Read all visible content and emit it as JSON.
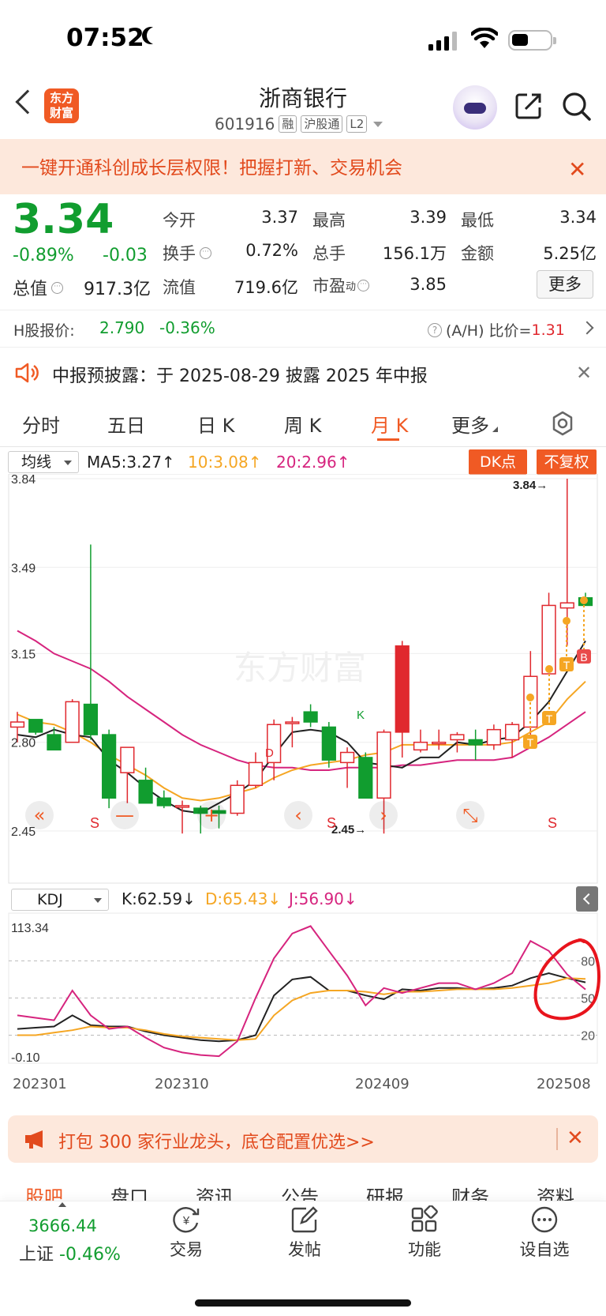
{
  "status_bar": {
    "time": "07:52"
  },
  "header": {
    "logo_text": "东方财富",
    "title": "浙商银行",
    "code": "601916",
    "tags": [
      "融",
      "沪股通",
      "L2"
    ]
  },
  "promo": {
    "text": "一键开通科创成长层权限！把握打新、交易机会",
    "close": "✕"
  },
  "quote": {
    "price": "3.34",
    "change_pct": "-0.89%",
    "change": "-0.03",
    "market_cap_label": "总值",
    "market_cap": "917.3亿",
    "fields": [
      {
        "label": "今开",
        "value": "3.37",
        "color": "#222222"
      },
      {
        "label": "最高",
        "value": "3.39",
        "color": "#e0282e"
      },
      {
        "label": "最低",
        "value": "3.34",
        "color": "#119d2f"
      },
      {
        "label": "换手",
        "value": "0.72%",
        "color": "#222222"
      },
      {
        "label": "总手",
        "value": "156.1万",
        "color": "#222222"
      },
      {
        "label": "金额",
        "value": "5.25亿",
        "color": "#222222"
      },
      {
        "label": "流值",
        "value": "719.6亿",
        "color": "#222222"
      },
      {
        "label": "市盈",
        "value": "3.85",
        "color": "#222222"
      }
    ],
    "pe_sup": "动",
    "more_label": "更多"
  },
  "hshare": {
    "label": "H股报价:",
    "price": "2.790",
    "change": "-0.36%",
    "ah_label": "(A/H) 比价=",
    "ah_value": "1.31"
  },
  "notice": {
    "text": "中报预披露：于 2025-08-29 披露 2025 年中报"
  },
  "period_tabs": [
    "分时",
    "五日",
    "日 K",
    "周 K",
    "月 K",
    "更多"
  ],
  "active_tab": "月 K",
  "indicators": {
    "ma_select": "均线",
    "ma5": "MA5:3.27↑",
    "ma10": "10:3.08↑",
    "ma20": "20:2.96↑",
    "dk_button": "DK点",
    "fq_button": "不复权",
    "kdj_select": "KDJ",
    "kdj_k": "K:62.59↓",
    "kdj_d": "D:65.43↓",
    "kdj_j": "J:56.90↓"
  },
  "colors": {
    "up": "#e0282e",
    "down": "#119d2f",
    "ma5": "#222222",
    "ma10": "#f5a623",
    "ma20": "#d6247e",
    "accent": "#f05a24"
  },
  "chart_data": [
    {
      "type": "candlestick",
      "title": "",
      "y_ticks": [
        "3.84",
        "3.49",
        "3.15",
        "2.80",
        "2.45"
      ],
      "ylim": [
        2.45,
        3.84
      ],
      "annotations": {
        "high": "3.84→",
        "low": "2.45→",
        "watermark": "东方财富",
        "markers": [
          "S",
          "S",
          "S",
          "S",
          "D",
          "B",
          "K",
          "T",
          "T",
          "T",
          "T"
        ]
      },
      "candles": [
        {
          "o": 2.86,
          "h": 2.92,
          "l": 2.8,
          "c": 2.88
        },
        {
          "o": 2.89,
          "h": 2.88,
          "l": 2.83,
          "c": 2.84
        },
        {
          "o": 2.83,
          "h": 2.86,
          "l": 2.77,
          "c": 2.77
        },
        {
          "o": 2.8,
          "h": 2.97,
          "l": 2.8,
          "c": 2.96
        },
        {
          "o": 2.95,
          "h": 3.58,
          "l": 2.81,
          "c": 2.83
        },
        {
          "o": 2.83,
          "h": 2.85,
          "l": 2.54,
          "c": 2.58
        },
        {
          "o": 2.68,
          "h": 2.7,
          "l": 2.56,
          "c": 2.78
        },
        {
          "o": 2.65,
          "h": 2.7,
          "l": 2.56,
          "c": 2.56
        },
        {
          "o": 2.58,
          "h": 2.61,
          "l": 2.54,
          "c": 2.55
        },
        {
          "o": 2.55,
          "h": 2.57,
          "l": 2.44,
          "c": 2.55
        },
        {
          "o": 2.54,
          "h": 2.55,
          "l": 2.44,
          "c": 2.52
        },
        {
          "o": 2.53,
          "h": 2.55,
          "l": 2.46,
          "c": 2.52
        },
        {
          "o": 2.52,
          "h": 2.65,
          "l": 2.51,
          "c": 2.63
        },
        {
          "o": 2.63,
          "h": 2.76,
          "l": 2.62,
          "c": 2.72
        },
        {
          "o": 2.72,
          "h": 2.89,
          "l": 2.65,
          "c": 2.87
        },
        {
          "o": 2.88,
          "h": 2.9,
          "l": 2.78,
          "c": 2.88
        },
        {
          "o": 2.92,
          "h": 2.95,
          "l": 2.86,
          "c": 2.88
        },
        {
          "o": 2.86,
          "h": 2.88,
          "l": 2.7,
          "c": 2.73
        },
        {
          "o": 2.72,
          "h": 2.78,
          "l": 2.62,
          "c": 2.76
        },
        {
          "o": 2.74,
          "h": 2.76,
          "l": 2.58,
          "c": 2.58
        },
        {
          "o": 2.58,
          "h": 2.85,
          "l": 2.44,
          "c": 2.84
        },
        {
          "o": 2.84,
          "h": 3.2,
          "l": 2.74,
          "c": 3.18
        },
        {
          "o": 2.77,
          "h": 2.85,
          "l": 2.76,
          "c": 2.8
        },
        {
          "o": 2.8,
          "h": 2.85,
          "l": 2.77,
          "c": 2.8
        },
        {
          "o": 2.81,
          "h": 2.84,
          "l": 2.76,
          "c": 2.83
        },
        {
          "o": 2.81,
          "h": 2.85,
          "l": 2.73,
          "c": 2.79
        },
        {
          "o": 2.79,
          "h": 2.87,
          "l": 2.77,
          "c": 2.85
        },
        {
          "o": 2.81,
          "h": 2.88,
          "l": 2.74,
          "c": 2.87
        },
        {
          "o": 2.86,
          "h": 3.16,
          "l": 2.83,
          "c": 3.06
        },
        {
          "o": 3.07,
          "h": 3.39,
          "l": 3.07,
          "c": 3.34
        },
        {
          "o": 3.33,
          "h": 3.84,
          "l": 3.18,
          "c": 3.35
        },
        {
          "o": 3.37,
          "h": 3.39,
          "l": 3.34,
          "c": 3.34
        }
      ],
      "ma5": [
        2.83,
        2.82,
        2.85,
        2.83,
        2.82,
        2.73,
        2.68,
        2.62,
        2.57,
        2.53,
        2.52,
        2.56,
        2.6,
        2.65,
        2.75,
        2.84,
        2.85,
        2.84,
        2.8,
        2.72,
        2.71,
        2.7,
        2.74,
        2.74,
        2.8,
        2.79,
        2.81,
        2.82,
        2.88,
        2.96,
        3.08,
        3.2
      ],
      "ma10": [
        2.91,
        2.88,
        2.87,
        2.84,
        2.8,
        2.75,
        2.71,
        2.67,
        2.62,
        2.58,
        2.57,
        2.58,
        2.6,
        2.62,
        2.66,
        2.69,
        2.71,
        2.72,
        2.73,
        2.75,
        2.76,
        2.79,
        2.79,
        2.79,
        2.79,
        2.79,
        2.79,
        2.8,
        2.84,
        2.88,
        2.97,
        3.04
      ],
      "ma20": [
        3.24,
        3.2,
        3.15,
        3.12,
        3.09,
        3.04,
        2.98,
        2.93,
        2.88,
        2.83,
        2.79,
        2.76,
        2.73,
        2.71,
        2.7,
        2.7,
        2.69,
        2.69,
        2.7,
        2.7,
        2.7,
        2.71,
        2.71,
        2.72,
        2.73,
        2.73,
        2.73,
        2.74,
        2.78,
        2.82,
        2.87,
        2.92
      ]
    },
    {
      "type": "line",
      "title": "",
      "y_ticks_left": [
        "113.34",
        "-0.10"
      ],
      "y_ticks_right": [
        "80",
        "50",
        "20"
      ],
      "x_ticks": [
        "202301",
        "202310",
        "202409",
        "202508"
      ],
      "ylim": [
        -0.1,
        113.34
      ],
      "series": [
        {
          "name": "K",
          "color": "#222222",
          "values": [
            25,
            26,
            27,
            36,
            28,
            27,
            27,
            23,
            20,
            18,
            16,
            15,
            16,
            20,
            52,
            65,
            67,
            56,
            56,
            52,
            49,
            57,
            56,
            58,
            58,
            57,
            58,
            60,
            66,
            70,
            66,
            62.59
          ]
        },
        {
          "name": "D",
          "color": "#f5a623",
          "values": [
            20,
            20,
            22,
            24,
            27,
            26,
            26,
            24,
            21,
            19,
            18,
            17,
            16,
            17,
            36,
            48,
            54,
            56,
            56,
            55,
            53,
            55,
            55,
            56,
            57,
            57,
            57,
            58,
            60,
            62,
            66,
            65.43
          ]
        },
        {
          "name": "J",
          "color": "#d6247e",
          "values": [
            36,
            34,
            32,
            56,
            36,
            25,
            27,
            18,
            10,
            6,
            4,
            3,
            15,
            50,
            82,
            102,
            108,
            88,
            68,
            44,
            58,
            54,
            58,
            62,
            62,
            57,
            62,
            70,
            96,
            88,
            69,
            56.9
          ]
        }
      ]
    }
  ],
  "ad": {
    "text": "打包 300 家行业龙头，底仓配置优选>>",
    "close": "✕"
  },
  "content_tabs": [
    "股吧",
    "盘口",
    "资讯",
    "公告",
    "研报",
    "财务",
    "资料"
  ],
  "bottom_bar": {
    "index_value": "3666.44",
    "index_name": "上证",
    "index_change": "-0.46%",
    "nav": [
      "交易",
      "发帖",
      "功能",
      "设自选"
    ]
  }
}
